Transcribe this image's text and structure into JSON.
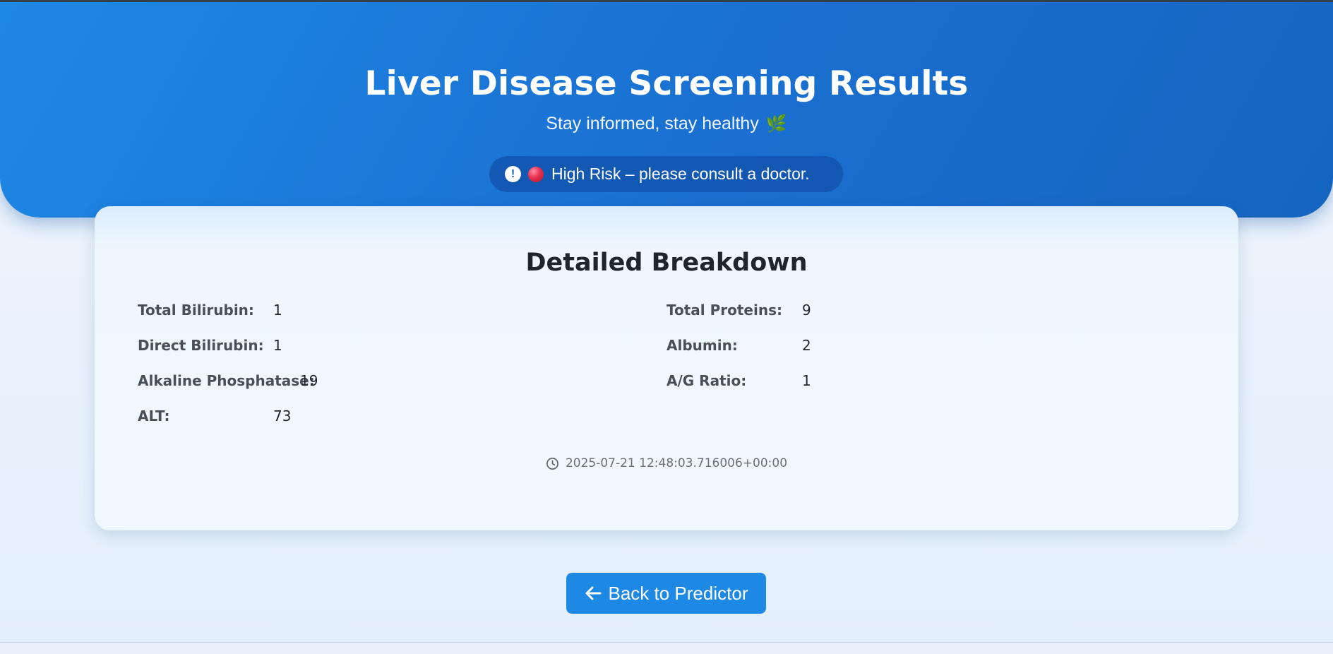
{
  "hero": {
    "title": "Liver Disease Screening Results",
    "subtitle": "Stay informed, stay healthy",
    "subtitle_icon": "leaf-icon",
    "risk_badge": {
      "icon": "exclamation-circle-icon",
      "status_icon": "red-circle-icon",
      "text": "High Risk – please consult a doctor."
    }
  },
  "breakdown": {
    "title": "Detailed Breakdown",
    "left_items": [
      {
        "label": "Total Bilirubin:",
        "value": "1"
      },
      {
        "label": "Direct Bilirubin:",
        "value": "1"
      },
      {
        "label": "Alkaline Phosphatase:",
        "value": "19"
      },
      {
        "label": "ALT:",
        "value": "73"
      }
    ],
    "right_items": [
      {
        "label": "Total Proteins:",
        "value": "9"
      },
      {
        "label": "Albumin:",
        "value": "2"
      },
      {
        "label": "A/G Ratio:",
        "value": "1"
      }
    ],
    "timestamp": "2025-07-21 12:48:03.716006+00:00",
    "timestamp_icon": "clock-icon"
  },
  "actions": {
    "back_label": "Back to Predictor",
    "back_icon": "arrow-left-icon"
  },
  "colors": {
    "hero_start": "#1e88e5",
    "hero_end": "#1565c0",
    "button": "#1e88e5",
    "risk_dot": "#e8304e"
  }
}
